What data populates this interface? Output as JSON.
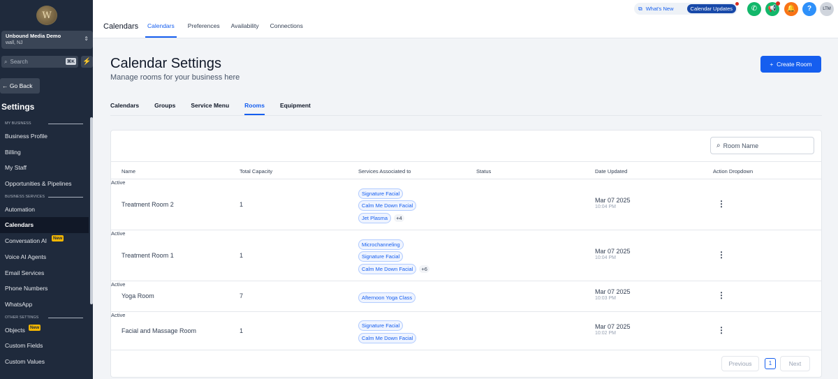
{
  "sidebar": {
    "logo_letter": "W",
    "account_name": "Unbound Media Demo",
    "account_location": "wall, NJ",
    "search_placeholder": "Search",
    "search_shortcut": "⌘K",
    "go_back": "Go Back",
    "settings_title": "Settings",
    "sections": [
      {
        "label": "MY BUSINESS",
        "items": [
          "Business Profile",
          "Billing",
          "My Staff",
          "Opportunities & Pipelines"
        ]
      },
      {
        "label": "BUSINESS SERVICES",
        "items": [
          "Automation",
          "Calendars",
          "Conversation AI",
          "Voice AI Agents",
          "Email Services",
          "Phone Numbers",
          "WhatsApp"
        ]
      },
      {
        "label": "OTHER SETTINGS",
        "items": [
          "Objects",
          "Custom Fields",
          "Custom Values"
        ]
      }
    ],
    "badge_new": "New",
    "active_item": "Calendars"
  },
  "topbar": {
    "section_title": "Calendars",
    "tabs": [
      "Calendars",
      "Preferences",
      "Availability",
      "Connections"
    ],
    "active_tab": "Calendars",
    "whats_new": "What's New",
    "calendar_updates": "Calendar Updates",
    "avatar_text": "LTM",
    "icon_colors": {
      "phone": "#12b76a",
      "megaphone": "#12b76a",
      "bell": "#f97316",
      "help": "#2e90fa"
    }
  },
  "main": {
    "title": "Calendar Settings",
    "subtitle": "Manage rooms for your business here",
    "create_button": "Create Room",
    "subtabs": [
      "Calendars",
      "Groups",
      "Service Menu",
      "Rooms",
      "Equipment"
    ],
    "active_subtab": "Rooms",
    "search_placeholder": "Room Name",
    "columns": [
      "Name",
      "Total Capacity",
      "Services Associated to",
      "Status",
      "Date Updated",
      "Action Dropdown"
    ],
    "rows": [
      {
        "name": "Treatment Room 2",
        "capacity": "1",
        "services": [
          "Signature Facial",
          "Calm Me Down Facial",
          "Jet Plasma"
        ],
        "more": "+4",
        "status": "Active",
        "date": "Mar 07 2025",
        "time": "10:04 PM"
      },
      {
        "name": "Treatment Room 1",
        "capacity": "1",
        "services": [
          "Microchanneling",
          "Signature Facial",
          "Calm Me Down Facial"
        ],
        "more": "+6",
        "status": "Active",
        "date": "Mar 07 2025",
        "time": "10:04 PM"
      },
      {
        "name": "Yoga Room",
        "capacity": "7",
        "services": [
          "Afternoon Yoga Class"
        ],
        "more": "",
        "status": "Active",
        "date": "Mar 07 2025",
        "time": "10:03 PM"
      },
      {
        "name": "Facial and Massage Room",
        "capacity": "1",
        "services": [
          "Signature Facial",
          "Calm Me Down Facial"
        ],
        "more": "",
        "status": "Active",
        "date": "Mar 07 2025",
        "time": "10:02 PM"
      }
    ],
    "pagination": {
      "previous": "Previous",
      "page": "1",
      "next": "Next"
    }
  }
}
